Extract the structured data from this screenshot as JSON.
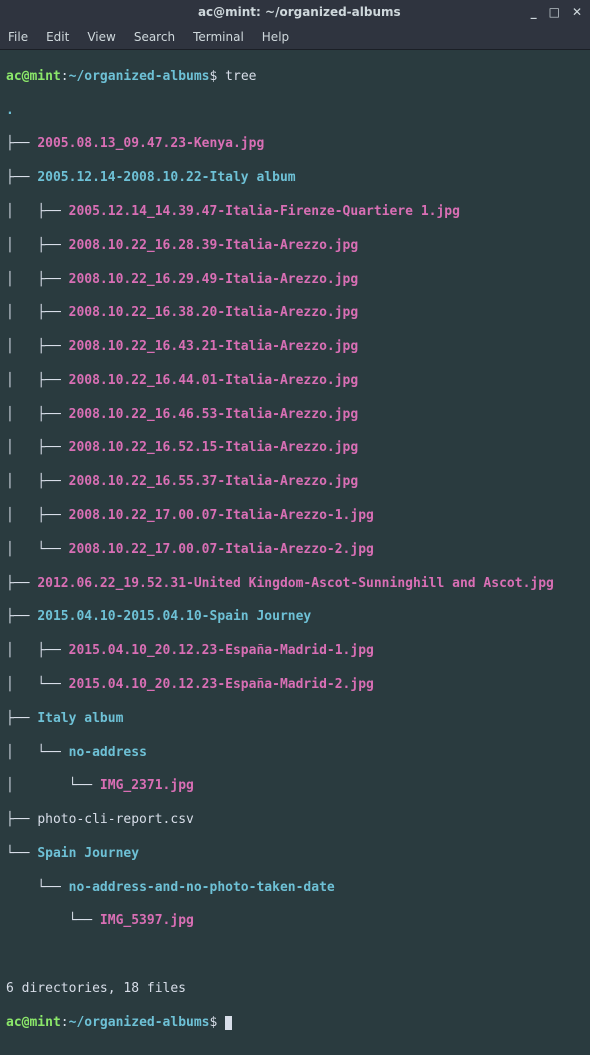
{
  "titlebar": {
    "title": "ac@mint: ~/organized-albums",
    "min": "_",
    "max": "□",
    "close": "✕"
  },
  "menubar": {
    "file": "File",
    "edit": "Edit",
    "view": "View",
    "search": "Search",
    "terminal": "Terminal",
    "help": "Help"
  },
  "prompt": {
    "user_host": "ac@mint",
    "colon": ":",
    "path": "~/organized-albums",
    "dollar": "$ ",
    "cmd_tree": "tree"
  },
  "tree": {
    "root": ".",
    "e0": {
      "b": "├── ",
      "n": "2005.08.13_09.47.23-Kenya.jpg"
    },
    "e1": {
      "b": "├── ",
      "n": "2005.12.14-2008.10.22-Italy album"
    },
    "e2": {
      "b": "│   ├── ",
      "n": "2005.12.14_14.39.47-Italia-Firenze-Quartiere 1.jpg"
    },
    "e3": {
      "b": "│   ├── ",
      "n": "2008.10.22_16.28.39-Italia-Arezzo.jpg"
    },
    "e4": {
      "b": "│   ├── ",
      "n": "2008.10.22_16.29.49-Italia-Arezzo.jpg"
    },
    "e5": {
      "b": "│   ├── ",
      "n": "2008.10.22_16.38.20-Italia-Arezzo.jpg"
    },
    "e6": {
      "b": "│   ├── ",
      "n": "2008.10.22_16.43.21-Italia-Arezzo.jpg"
    },
    "e7": {
      "b": "│   ├── ",
      "n": "2008.10.22_16.44.01-Italia-Arezzo.jpg"
    },
    "e8": {
      "b": "│   ├── ",
      "n": "2008.10.22_16.46.53-Italia-Arezzo.jpg"
    },
    "e9": {
      "b": "│   ├── ",
      "n": "2008.10.22_16.52.15-Italia-Arezzo.jpg"
    },
    "e10": {
      "b": "│   ├── ",
      "n": "2008.10.22_16.55.37-Italia-Arezzo.jpg"
    },
    "e11": {
      "b": "│   ├── ",
      "n": "2008.10.22_17.00.07-Italia-Arezzo-1.jpg"
    },
    "e12": {
      "b": "│   └── ",
      "n": "2008.10.22_17.00.07-Italia-Arezzo-2.jpg"
    },
    "e13": {
      "b": "├── ",
      "n": "2012.06.22_19.52.31-United Kingdom-Ascot-Sunninghill and Ascot.jpg"
    },
    "e14": {
      "b": "├── ",
      "n": "2015.04.10-2015.04.10-Spain Journey"
    },
    "e15": {
      "b": "│   ├── ",
      "n": "2015.04.10_20.12.23-España-Madrid-1.jpg"
    },
    "e16": {
      "b": "│   └── ",
      "n": "2015.04.10_20.12.23-España-Madrid-2.jpg"
    },
    "e17": {
      "b": "├── ",
      "n": "Italy album"
    },
    "e18": {
      "b": "│   └── ",
      "n": "no-address"
    },
    "e19": {
      "b": "│       └── ",
      "n": "IMG_2371.jpg"
    },
    "e20": {
      "b": "├── ",
      "n": "photo-cli-report.csv"
    },
    "e21": {
      "b": "└── ",
      "n": "Spain Journey"
    },
    "e22": {
      "b": "    └── ",
      "n": "no-address-and-no-photo-taken-date"
    },
    "e23": {
      "b": "        └── ",
      "n": "IMG_5397.jpg"
    }
  },
  "summary": "6 directories, 18 files"
}
